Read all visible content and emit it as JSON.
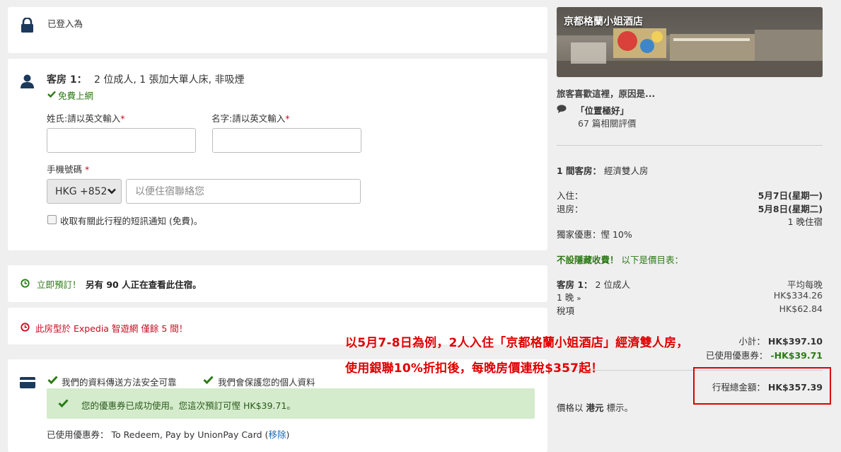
{
  "login": {
    "text": "已登入為"
  },
  "room": {
    "title": "客房 1：",
    "desc": "2 位成人, 1 張加大單人床, 非吸煙",
    "wifi": "免費上網",
    "surname_label": "姓氏:請以英文輸入",
    "given_label": "名字:請以英文輸入",
    "req_mark": "*",
    "phone_label": "手機號碼",
    "country_code": "HKG +852",
    "phone_placeholder": "以便住宿聯絡您",
    "sms_label": "收取有關此行程的短訊通知 (免費)。"
  },
  "urgency": {
    "prefix": "立即預訂！",
    "bold": "另有 90 人正在查看此住宿。"
  },
  "scarcity": {
    "text": "此房型於 Expedia 智遊網 僅餘 5 間！"
  },
  "security": {
    "item1": "我們的資料傳送方法安全可靠",
    "item2": "我們會保護您的個人資料",
    "coupon_success": "您的優惠券已成功使用。您這次預訂可慳 HK$39.71。",
    "coupon_used_label": "已使用優惠券：",
    "coupon_name": "To Redeem, Pay by UnionPay Card",
    "coupon_remove_open": "(",
    "coupon_remove": "移除",
    "coupon_remove_close": ")"
  },
  "hotel": {
    "name": "京都格蘭小姐酒店",
    "why_title": "旅客喜歡這裡，原因是...",
    "highlight": "「位置極好」",
    "reviews": "67 篇相關評價"
  },
  "summary": {
    "rooms_label": "1 間客房：",
    "room_type": "經濟雙人房",
    "checkin_label": "入住：",
    "checkin_date": "5月7日(星期一)",
    "checkout_label": "退房：",
    "checkout_date": "5月8日(星期二)",
    "nights": "1 晚住宿",
    "exclusive": "獨家優惠：慳 10%",
    "no_hidden_bold": "不設隱藏收費！",
    "no_hidden_rest": "以下是價目表：",
    "room1_label": "客房 1：",
    "room1_guests": "2 位成人",
    "avg_label": "平均每晚",
    "night_link": "1 晚",
    "night_price": "HK$334.26",
    "tax_link": "稅項",
    "tax_price": "HK$62.84",
    "subtotal_label": "小計：",
    "subtotal": "HK$397.10",
    "coupon_label": "已使用優惠券：",
    "coupon_amount": "-HK$39.71",
    "total_label": "行程總金額：",
    "total": "HK$357.39",
    "currency_note_pre": "價格以",
    "currency_note_bold": "港元",
    "currency_note_post": "標示。"
  },
  "promo": {
    "line1": "以5月7-8日為例，2人入住「京都格蘭小姐酒店」經濟雙人房，",
    "line2": "使用銀聯10%折扣後，每晚房價連稅$357起！"
  },
  "colors": {
    "navy": "#1b3a5c",
    "green": "#2c7a16",
    "red": "#c60b1e",
    "link": "#1b69b6",
    "highlight": "#e00000"
  }
}
